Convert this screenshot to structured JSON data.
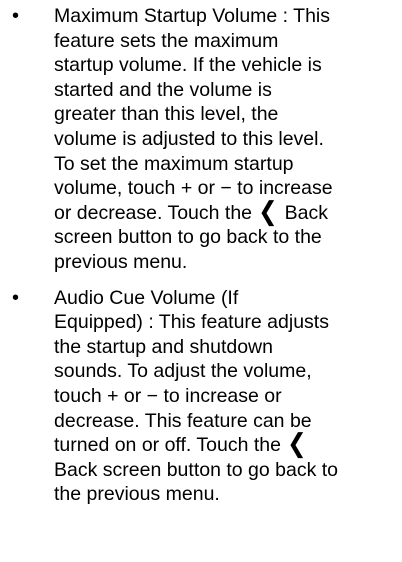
{
  "items": [
    {
      "bullet": "•",
      "line_1": "Maximum Startup Volume : This",
      "line_2": "feature sets the maximum",
      "line_3": "startup volume. If the vehicle is",
      "line_4": "started and the volume is",
      "line_5": "greater than this level, the",
      "line_6": "volume is adjusted to this level.",
      "line_7": "To set the maximum startup",
      "line_8": "volume, touch + or − to increase",
      "line_9_a": "or decrease. Touch the ",
      "back_symbol": "❮",
      "line_9_b": " Back",
      "line_10": "screen button to go back to the",
      "line_11": "previous menu."
    },
    {
      "bullet": "•",
      "line_1": "Audio Cue Volume (If",
      "line_2": "Equipped) : This feature adjusts",
      "line_3": "the startup and shutdown",
      "line_4": "sounds. To adjust the volume,",
      "line_5": "touch + or − to increase or",
      "line_6": "decrease. This feature can be",
      "line_7_a": "turned on or off. Touch the ",
      "back_symbol": "❮",
      "line_8": "Back screen button to go back to",
      "line_9": "the previous menu."
    }
  ]
}
